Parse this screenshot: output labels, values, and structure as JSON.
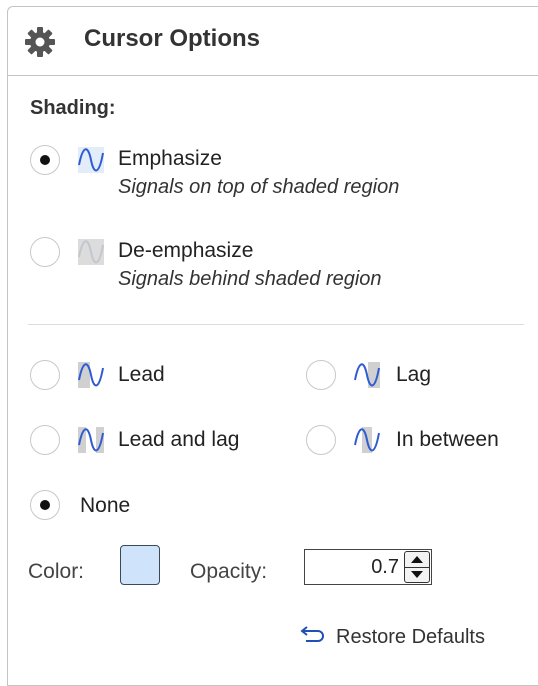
{
  "panel": {
    "title": "Cursor Options",
    "icon": "gear-icon"
  },
  "shading": {
    "label": "Shading:",
    "options": [
      {
        "title": "Emphasize",
        "description": "Signals on top of shaded region",
        "checked": true,
        "icon": "emphasize-wave-icon"
      },
      {
        "title": "De-emphasize",
        "description": "Signals behind shaded region",
        "checked": false,
        "icon": "deemphasize-wave-icon"
      }
    ]
  },
  "region": {
    "options": [
      {
        "label": "Lead",
        "checked": false,
        "icon": "lead-wave-icon"
      },
      {
        "label": "Lag",
        "checked": false,
        "icon": "lag-wave-icon"
      },
      {
        "label": "Lead and lag",
        "checked": false,
        "icon": "lead-and-lag-wave-icon"
      },
      {
        "label": "In between",
        "checked": false,
        "icon": "in-between-wave-icon"
      },
      {
        "label": "None",
        "checked": true
      }
    ]
  },
  "color": {
    "label": "Color:",
    "value": "#cfe3fb"
  },
  "opacity": {
    "label": "Opacity:",
    "value": "0.7"
  },
  "restore": {
    "label": "Restore Defaults",
    "icon": "undo-arrow-icon"
  },
  "colors": {
    "wave": "#2f5bd3",
    "shade": "#d0d0d0",
    "swatch": "#cfe3fb"
  }
}
